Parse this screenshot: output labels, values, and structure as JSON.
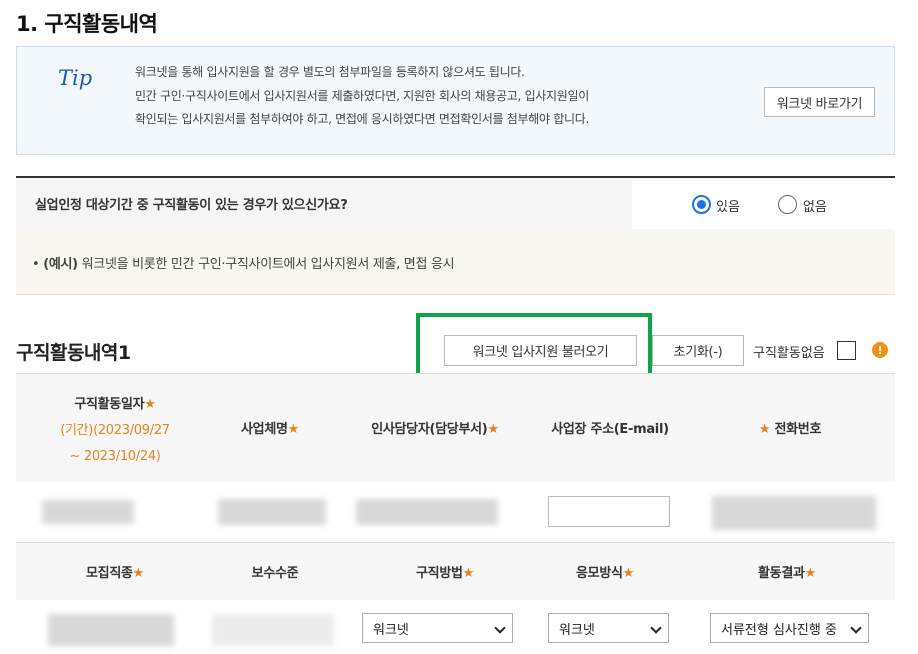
{
  "section": {
    "title": "1. 구직활동내역"
  },
  "tip": {
    "label": "Tip",
    "lines": [
      "워크넷을 통해 입사지원을 할 경우 별도의 첨부파일을 등록하지 않으셔도 됩니다.",
      "민간 구인·구직사이트에서 입사지원서를 제출하였다면, 지원한 회사의 채용공고, 입사지원일이",
      "확인되는 입사지원서를 첨부하여야 하고, 면접에 응시하였다면 면접확인서를 첨부해야 합니다."
    ],
    "worknet_button": "워크넷 바로가기"
  },
  "question": {
    "text": "실업인정 대상기간 중 구직활동이 있는 경우가 있으신가요?",
    "yes": "있음",
    "no": "없음"
  },
  "example": {
    "prefix": "(예시)",
    "text": " 워크넷을 비롯한 민간 구인·구직사이트에서 입사지원서 제출, 면접 응시"
  },
  "activity": {
    "title": "구직활동내역1",
    "load_button": "워크넷 입사지원 불러오기",
    "reset_button": "초기화(-)",
    "none_label": "구직활동없음",
    "warn": "!"
  },
  "table1": {
    "date": "구직활동일자",
    "period_line1": "(기간)(2023/09/27",
    "period_line2": "~ 2023/10/24)",
    "company": "사업체명",
    "manager": "인사담당자(담당부서)",
    "email": "사업장 주소(E-mail)",
    "phone": "전화번호"
  },
  "table2": {
    "job": "모집직종",
    "salary": "보수수준",
    "method": "구직방법",
    "apply": "응모방식",
    "result": "활동결과"
  },
  "row2": {
    "method_value": "워크넷",
    "apply_value": "워크넷",
    "result_value": "서류전형 심사진행 중"
  },
  "required_mark": "★",
  "colors": {
    "accent": "#1a73e8",
    "required": "#e8821a",
    "highlight": "#0fa34a",
    "warn": "#f39019"
  }
}
